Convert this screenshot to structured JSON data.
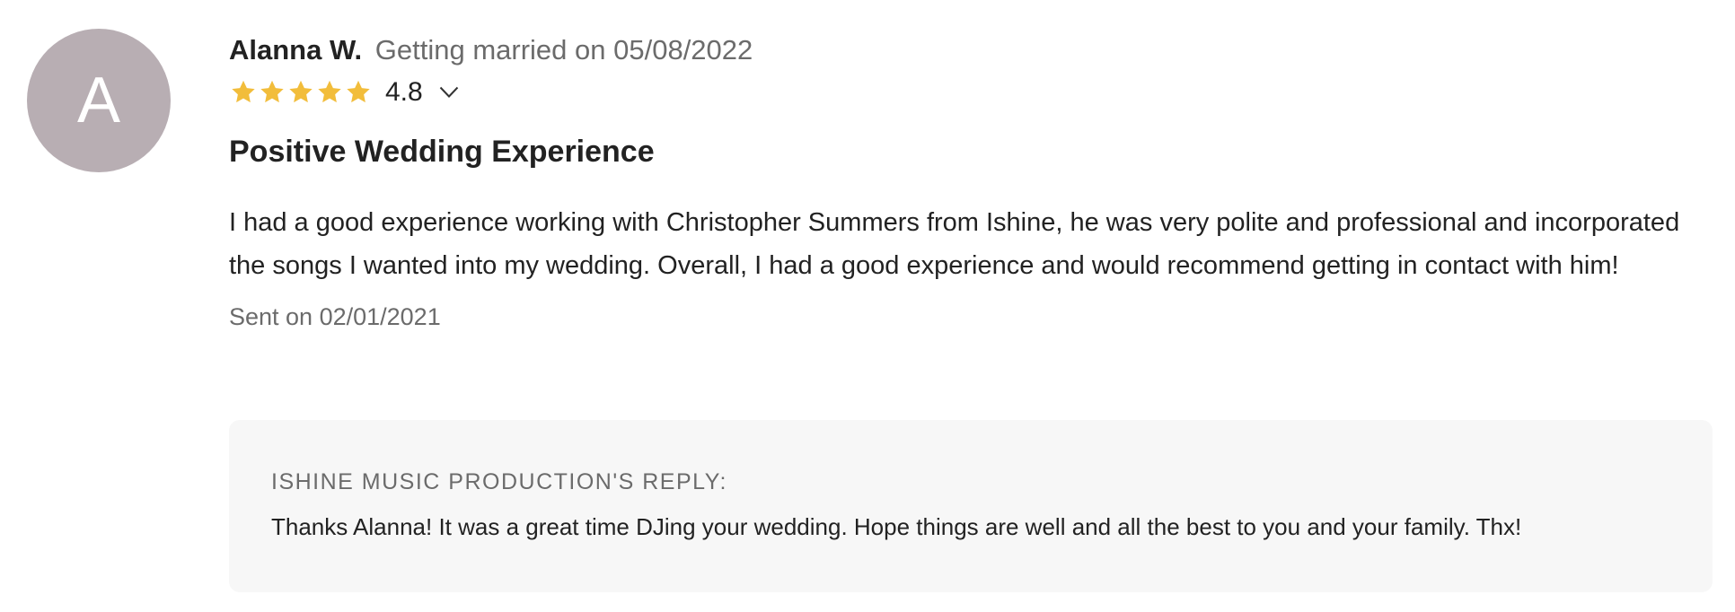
{
  "reviewer": {
    "initial": "A",
    "name": "Alanna W.",
    "wedding_date_text": "Getting married on 05/08/2022",
    "avatar_color": "#b8aeb3"
  },
  "rating": {
    "value_text": "4.8",
    "stars": 5,
    "star_color": "#f2bd3b",
    "chevron_icon": "chevron-down-icon"
  },
  "review": {
    "title": "Positive Wedding Experience",
    "body": "I had a good experience working with Christopher Summers from Ishine, he was very polite and professional and incorporated the songs I wanted into my wedding. Overall, I had a good experience and would recommend getting in contact with him!",
    "sent_text": "Sent on 02/01/2021"
  },
  "reply": {
    "title": "ISHINE MUSIC PRODUCTION'S REPLY:",
    "text": "Thanks Alanna! It was a great time DJing your wedding. Hope things are well and all the best to you and your family. Thx!"
  }
}
